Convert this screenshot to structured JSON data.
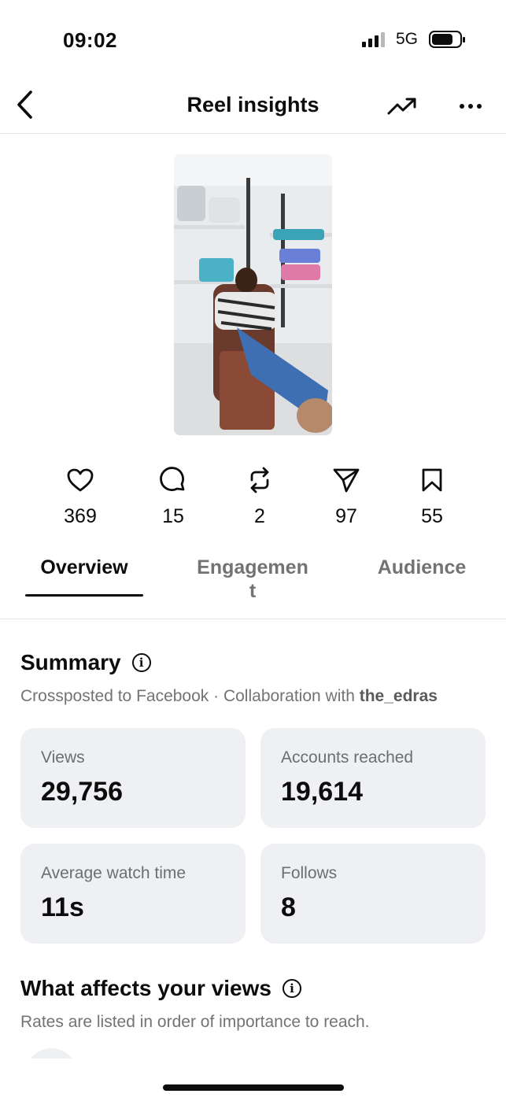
{
  "status_bar": {
    "time": "09:02",
    "network": "5G"
  },
  "header": {
    "title": "Reel insights",
    "back_icon": "chevron-left-icon",
    "trend_icon": "trending-up-icon",
    "more_icon": "more-horizontal-icon"
  },
  "stats": {
    "likes": "369",
    "comments": "15",
    "reposts": "2",
    "shares": "97",
    "saves": "55"
  },
  "tabs": {
    "overview": "Overview",
    "engagement_line1": "Engagemen",
    "engagement_line2": "t",
    "audience": "Audience"
  },
  "summary": {
    "title": "Summary",
    "crosspost_text": "Crossposted to Facebook · Collaboration with ",
    "collaborator": "the_edras",
    "cards": {
      "views_label": "Views",
      "views_value": "29,756",
      "reached_label": "Accounts reached",
      "reached_value": "19,614",
      "watch_label": "Average watch time",
      "watch_value": "11s",
      "follows_label": "Follows",
      "follows_value": "8"
    }
  },
  "affects": {
    "title": "What affects your views",
    "subtitle": "Rates are listed in order of importance to reach."
  },
  "colors": {
    "text": "#0c0c0c",
    "muted": "#737373",
    "card_bg": "#eff0f3",
    "divider": "#e6e7ea"
  }
}
